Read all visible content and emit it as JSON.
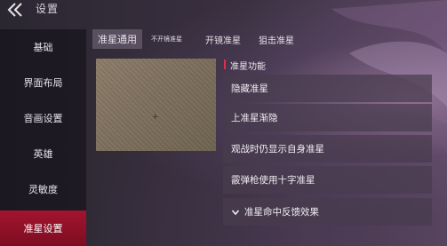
{
  "header": {
    "title": "设置"
  },
  "sidebar": {
    "items": [
      {
        "label": "基础"
      },
      {
        "label": "界面布局"
      },
      {
        "label": "音画设置"
      },
      {
        "label": "英雄"
      },
      {
        "label": "灵敏度"
      },
      {
        "label": "准星设置",
        "active": true
      }
    ]
  },
  "tabs": [
    {
      "label": "准星通用",
      "active": true
    },
    {
      "label": "不开镜准星"
    },
    {
      "label": "开镜准星"
    },
    {
      "label": "狙击准星"
    }
  ],
  "section": {
    "title": "准星功能"
  },
  "options": [
    {
      "label": "隐藏准星"
    },
    {
      "label": "上准星渐隐"
    },
    {
      "label": "观战时仍显示自身准星"
    },
    {
      "label": "霰弹枪使用十字准星"
    },
    {
      "label": "准星命中反馈效果",
      "icon": "chevron-down-icon"
    }
  ],
  "preview": {
    "crosshair": "+"
  },
  "colors": {
    "accent": "#a2142e",
    "section_marker": "#d8304c"
  }
}
